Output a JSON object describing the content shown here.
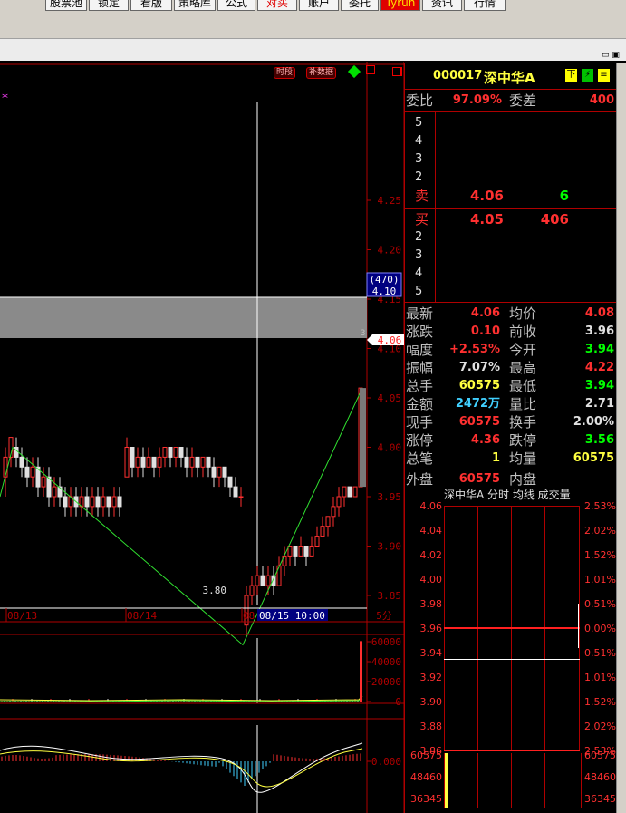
{
  "toolbar": {
    "items": [
      {
        "label": "股票池",
        "style": "normal"
      },
      {
        "label": "锁定",
        "style": "normal"
      },
      {
        "label": "看版",
        "style": "normal"
      },
      {
        "label": "策略库",
        "style": "normal"
      },
      {
        "label": "公式",
        "style": "normal"
      },
      {
        "label": "对买",
        "style": "red"
      },
      {
        "label": "账户",
        "style": "normal"
      },
      {
        "label": "委托",
        "style": "normal"
      },
      {
        "label": "Tyrun",
        "style": "hl"
      },
      {
        "label": "资讯",
        "style": "normal"
      },
      {
        "label": "行情",
        "style": "normal"
      }
    ]
  },
  "window_controls": "▭ ▣",
  "chart": {
    "buttons": {
      "period": "时段",
      "supplement": "补数据"
    },
    "price_ticks": [
      "4.25",
      "4.20",
      "4.15",
      "4.10",
      "4.05",
      "4.00",
      "3.95",
      "3.90",
      "3.85"
    ],
    "cursor_tag": {
      "volume": "(470)",
      "price": "4.10"
    },
    "last_price_tag": "4.06",
    "low_label": "3.80",
    "corner_marker": "3",
    "date_labels": [
      "08/13",
      "08/14",
      "08"
    ],
    "cursor_date": "08/15 10:00",
    "period_label": "5分",
    "volume_ticks": [
      "60000",
      "40000",
      "20000",
      "0"
    ],
    "macd_tick": "0.000"
  },
  "panel": {
    "code": "000017",
    "name": "深中华A",
    "icons": [
      "下",
      "⚡",
      "≡"
    ],
    "weibi": {
      "label": "委比",
      "value": "97.09%",
      "diff_label": "委差",
      "diff_value": "400"
    },
    "sell": [
      {
        "n": "5"
      },
      {
        "n": "4"
      },
      {
        "n": "3"
      },
      {
        "n": "2"
      },
      {
        "n": "卖",
        "price": "4.06",
        "vol": "6"
      }
    ],
    "buy": [
      {
        "n": "买",
        "price": "4.05",
        "vol": "406"
      },
      {
        "n": "2"
      },
      {
        "n": "3"
      },
      {
        "n": "4"
      },
      {
        "n": "5"
      }
    ],
    "stats": [
      {
        "l1": "最新",
        "v1": "4.06",
        "c1": "r",
        "l2": "均价",
        "v2": "4.08",
        "c2": "r"
      },
      {
        "l1": "涨跌",
        "v1": "0.10",
        "c1": "r",
        "l2": "前收",
        "v2": "3.96",
        "c2": "w"
      },
      {
        "l1": "幅度",
        "v1": "+2.53%",
        "c1": "r",
        "l2": "今开",
        "v2": "3.94",
        "c2": "g"
      },
      {
        "l1": "振幅",
        "v1": "7.07%",
        "c1": "w",
        "l2": "最高",
        "v2": "4.22",
        "c2": "r"
      },
      {
        "l1": "总手",
        "v1": "60575",
        "c1": "y",
        "l2": "最低",
        "v2": "3.94",
        "c2": "g"
      },
      {
        "l1": "金额",
        "v1": "2472万",
        "c1": "c",
        "l2": "量比",
        "v2": "2.71",
        "c2": "w"
      },
      {
        "l1": "现手",
        "v1": "60575",
        "c1": "r",
        "l2": "换手",
        "v2": "2.00%",
        "c2": "w"
      },
      {
        "l1": "涨停",
        "v1": "4.36",
        "c1": "r",
        "l2": "跌停",
        "v2": "3.56",
        "c2": "g"
      },
      {
        "l1": "总笔",
        "v1": "1",
        "c1": "y",
        "l2": "均量",
        "v2": "60575",
        "c2": "y"
      }
    ],
    "outer": {
      "label": "外盘",
      "value": "60575",
      "inner_label": "内盘"
    },
    "mini_title": "深中华A 分时 均线 成交量",
    "mini_left": [
      "4.06",
      "4.04",
      "4.02",
      "4.00",
      "3.98",
      "3.96",
      "3.94",
      "3.92",
      "3.90",
      "3.88",
      "3.86"
    ],
    "mini_right": [
      "2.53%",
      "2.02%",
      "1.52%",
      "1.01%",
      "0.51%",
      "0.00%",
      "0.51%",
      "1.01%",
      "1.52%",
      "2.02%",
      "2.53%"
    ],
    "mini_vol_left": [
      "60575",
      "48460",
      "36345"
    ],
    "mini_vol_right": [
      "60575",
      "48460",
      "36345"
    ]
  },
  "colors": {
    "up": "#ff3030",
    "down": "#00ffff",
    "avg": "#ffff40",
    "grid": "#b00000"
  }
}
